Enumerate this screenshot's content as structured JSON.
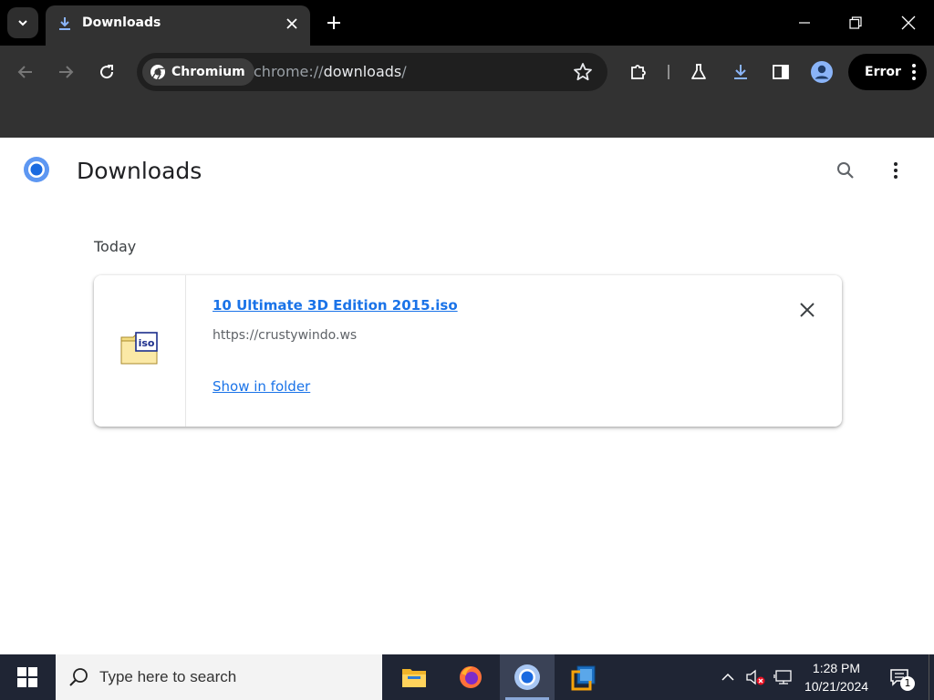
{
  "browser": {
    "tab": {
      "title": "Downloads"
    },
    "site_chip": "Chromium",
    "url_scheme": "chrome://",
    "url_host": "downloads",
    "url_rest": "/",
    "profile_button": "Error"
  },
  "page": {
    "title": "Downloads",
    "date_header": "Today",
    "downloads": [
      {
        "file_name": "10 Ultimate 3D Edition 2015.iso",
        "source_url": "https://crustywindo.ws",
        "action": "Show in folder",
        "icon": "iso-file-icon",
        "icon_label": "iso"
      }
    ]
  },
  "taskbar": {
    "search_placeholder": "Type here to search",
    "apps": [
      "file-explorer",
      "firefox",
      "chromium",
      "virtualbox"
    ],
    "active_app": "chromium",
    "time": "1:28 PM",
    "date": "10/21/2024",
    "notification_count": "1"
  },
  "colors": {
    "accent": "#1a73e8",
    "tab_bar": "#000000",
    "toolbar": "#323232",
    "taskbar": "#1f2534"
  }
}
